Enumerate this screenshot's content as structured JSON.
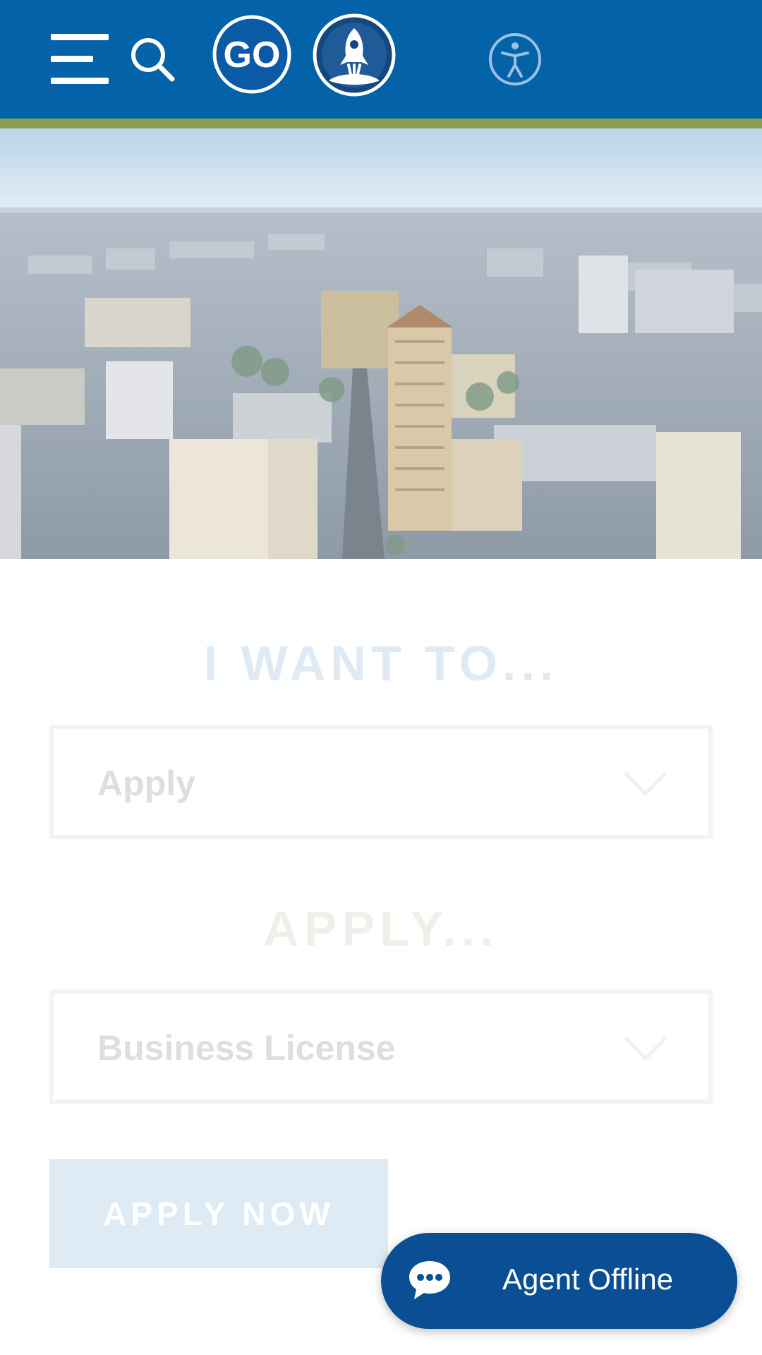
{
  "header": {
    "menu_icon": "hamburger-menu-icon",
    "search_icon": "search-icon",
    "logo_text": "GO",
    "rocket_icon": "rocket-logo-icon",
    "accessibility_icon": "accessibility-icon",
    "background_color": "#0462a8",
    "stripe_color": "#8a9f4c"
  },
  "hero": {
    "image": "aerial-city-skyline"
  },
  "i_want_to": {
    "title": "I WANT TO...",
    "selected": "Apply",
    "chevron_icon": "chevron-down-icon"
  },
  "apply": {
    "title": "APPLY...",
    "selected": "Business License",
    "chevron_icon": "chevron-down-icon",
    "button_label": "APPLY NOW"
  },
  "chat": {
    "label": "Agent Offline",
    "icon": "chat-bubble-icon",
    "color": "#0a4f93"
  }
}
